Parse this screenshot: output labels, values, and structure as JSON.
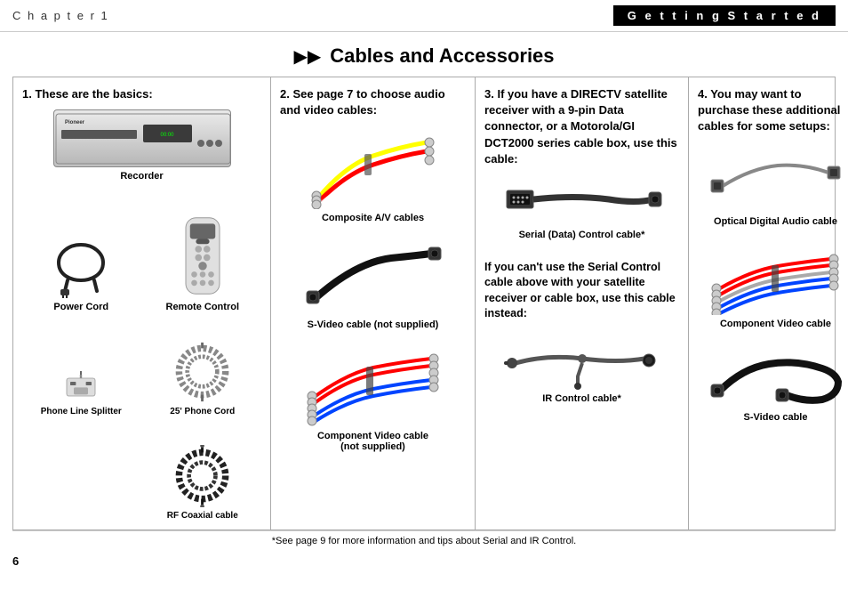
{
  "header": {
    "chapter": "C h a p t e r   1",
    "title": "G e t t i n g   S t a r t e d"
  },
  "page_title": "Cables and Accessories",
  "arrows": "▶▶",
  "columns": [
    {
      "id": "col1",
      "header": "1. These are the basics:",
      "items": [
        {
          "id": "recorder",
          "label": "Recorder",
          "span": "full"
        },
        {
          "id": "power-cord",
          "label": "Power Cord"
        },
        {
          "id": "remote-control",
          "label": "Remote Control"
        },
        {
          "id": "phone-splitter",
          "label": "Phone Line Splitter"
        },
        {
          "id": "phone-cord",
          "label": "25' Phone Cord"
        },
        {
          "id": "rf-coax",
          "label": "RF Coaxial cable"
        }
      ]
    },
    {
      "id": "col2",
      "header": "2. See page 7 to choose audio and video cables:",
      "items": [
        {
          "id": "composite-av",
          "label": "Composite A/V cables"
        },
        {
          "id": "svideo-ns",
          "label": "S-Video cable (not supplied)"
        },
        {
          "id": "component-ns",
          "label": "Component Video cable\n(not supplied)"
        }
      ]
    },
    {
      "id": "col3",
      "header": "3. If you have a DIRECTV satellite receiver with a 9-pin Data connector, or a Motorola/GI DCT2000 series cable box, use this cable:",
      "serial_label": "Serial (Data) Control cable*",
      "subtext": "If you can't use the Serial Control cable above with your satellite receiver or cable box, use this cable instead:",
      "ir_label": "IR Control cable*",
      "asterisk": "*See page 9 for more information and tips about Serial and IR Control."
    },
    {
      "id": "col4",
      "header": "4. You may want to purchase these additional cables for some setups:",
      "items": [
        {
          "id": "optical-digital",
          "label": "Optical Digital Audio cable"
        },
        {
          "id": "component-video",
          "label": "Component Video cable"
        },
        {
          "id": "svideo",
          "label": "S-Video cable"
        }
      ]
    }
  ],
  "footer": {
    "note": "*See page 9 for more information and tips about Serial and IR Control.",
    "page_number": "6"
  }
}
